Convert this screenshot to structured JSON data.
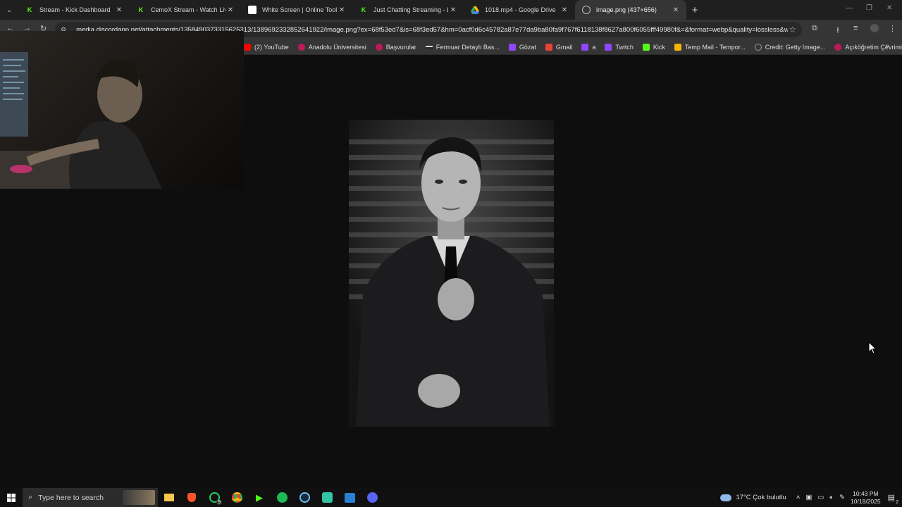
{
  "tabs": [
    {
      "label": "Stream - Kick Dashboard",
      "favicon": "kick-icon",
      "color": "#53fc18"
    },
    {
      "label": "CemoX Stream - Watch Live on",
      "favicon": "kick-icon",
      "color": "#53fc18"
    },
    {
      "label": "White Screen | Online Tool",
      "favicon": "white-screen-icon",
      "color": "#ffffff"
    },
    {
      "label": "Just Chatting Streaming - Live S",
      "favicon": "kick-icon",
      "color": "#53fc18"
    },
    {
      "label": "1018.mp4 - Google Drive",
      "favicon": "google-drive-icon",
      "color": "#4285f4"
    },
    {
      "label": "image.png (437×656)",
      "favicon": "globe-icon",
      "color": "#bdbdbd",
      "active": true
    }
  ],
  "address_bar": {
    "url": "media.discordapp.net/attachments/1358490373315625313/1389692332852641922/image.png?ex=68f53ed7&is=68f3ed57&hm=0acf0d6c45782a87e77da9ba80fa9f767f6118138f8627a800f6055fff49980f&=&format=webp&quality=lossless&w..."
  },
  "bookmarks": [
    {
      "label": "(2) YouTube",
      "color": "#ff0000"
    },
    {
      "label": "Anadolu Üniversitesi",
      "color": "#c2185b"
    },
    {
      "label": "Başvurular",
      "color": "#c2185b"
    },
    {
      "label": "Fermuar Detaylı Bas...",
      "color": "#333333"
    },
    {
      "label": "Gözat",
      "color": "#9146ff"
    },
    {
      "label": "Gmail",
      "color": "#ea4335"
    },
    {
      "label": "a",
      "color": "#9146ff"
    },
    {
      "label": "Twitch",
      "color": "#9146ff"
    },
    {
      "label": "Kick",
      "color": "#53fc18"
    },
    {
      "label": "Temp Mail - Tempor...",
      "color": "#f4b400"
    },
    {
      "label": "Credit: Getty Image...",
      "color": "#9e9e9e"
    },
    {
      "label": "Açıköğretim Çevrimi...",
      "color": "#c2185b"
    }
  ],
  "taskbar": {
    "search_placeholder": "Type here to search",
    "whatsapp_badge": "9",
    "weather": "17°C  Çok bulutlu",
    "time": "10:43 PM",
    "date": "10/18/2025",
    "notification_count": "2"
  }
}
